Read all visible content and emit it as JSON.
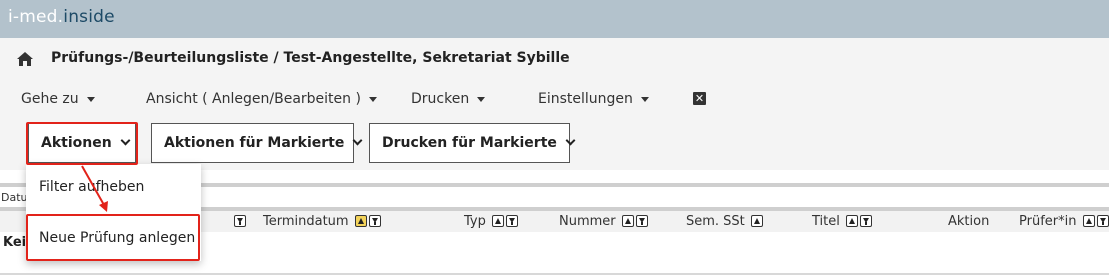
{
  "brand": {
    "part1": "i-med.",
    "part2": "inside"
  },
  "title": "Prüfungs-/Beurteilungsliste / Test-Angestellte, Sekretariat Sybille",
  "menu": {
    "goto": "Gehe zu",
    "view": "Ansicht ( Anlegen/Bearbeiten )",
    "print": "Drucken",
    "settings": "Einstellungen"
  },
  "close_glyph": "✕",
  "buttons": {
    "actions": "Aktionen",
    "actions_marked": "Aktionen für Markierte",
    "print_marked": "Drucken für Markierte"
  },
  "dropdown": {
    "items": [
      "Filter aufheben",
      "Neue Prüfung anlegen"
    ]
  },
  "datum_label": "Datu",
  "columns": {
    "termindatum": "Termindatum",
    "typ": "Typ",
    "nummer": "Nummer",
    "sem_sst": "Sem. SSt",
    "titel": "Titel",
    "aktion": "Aktion",
    "pruefer": "Prüfer*in"
  },
  "empty_text": "Keine",
  "colors": {
    "highlight": "#e2231a",
    "topbar": "#b3c2cc",
    "sort_active": "#f3d35a"
  }
}
